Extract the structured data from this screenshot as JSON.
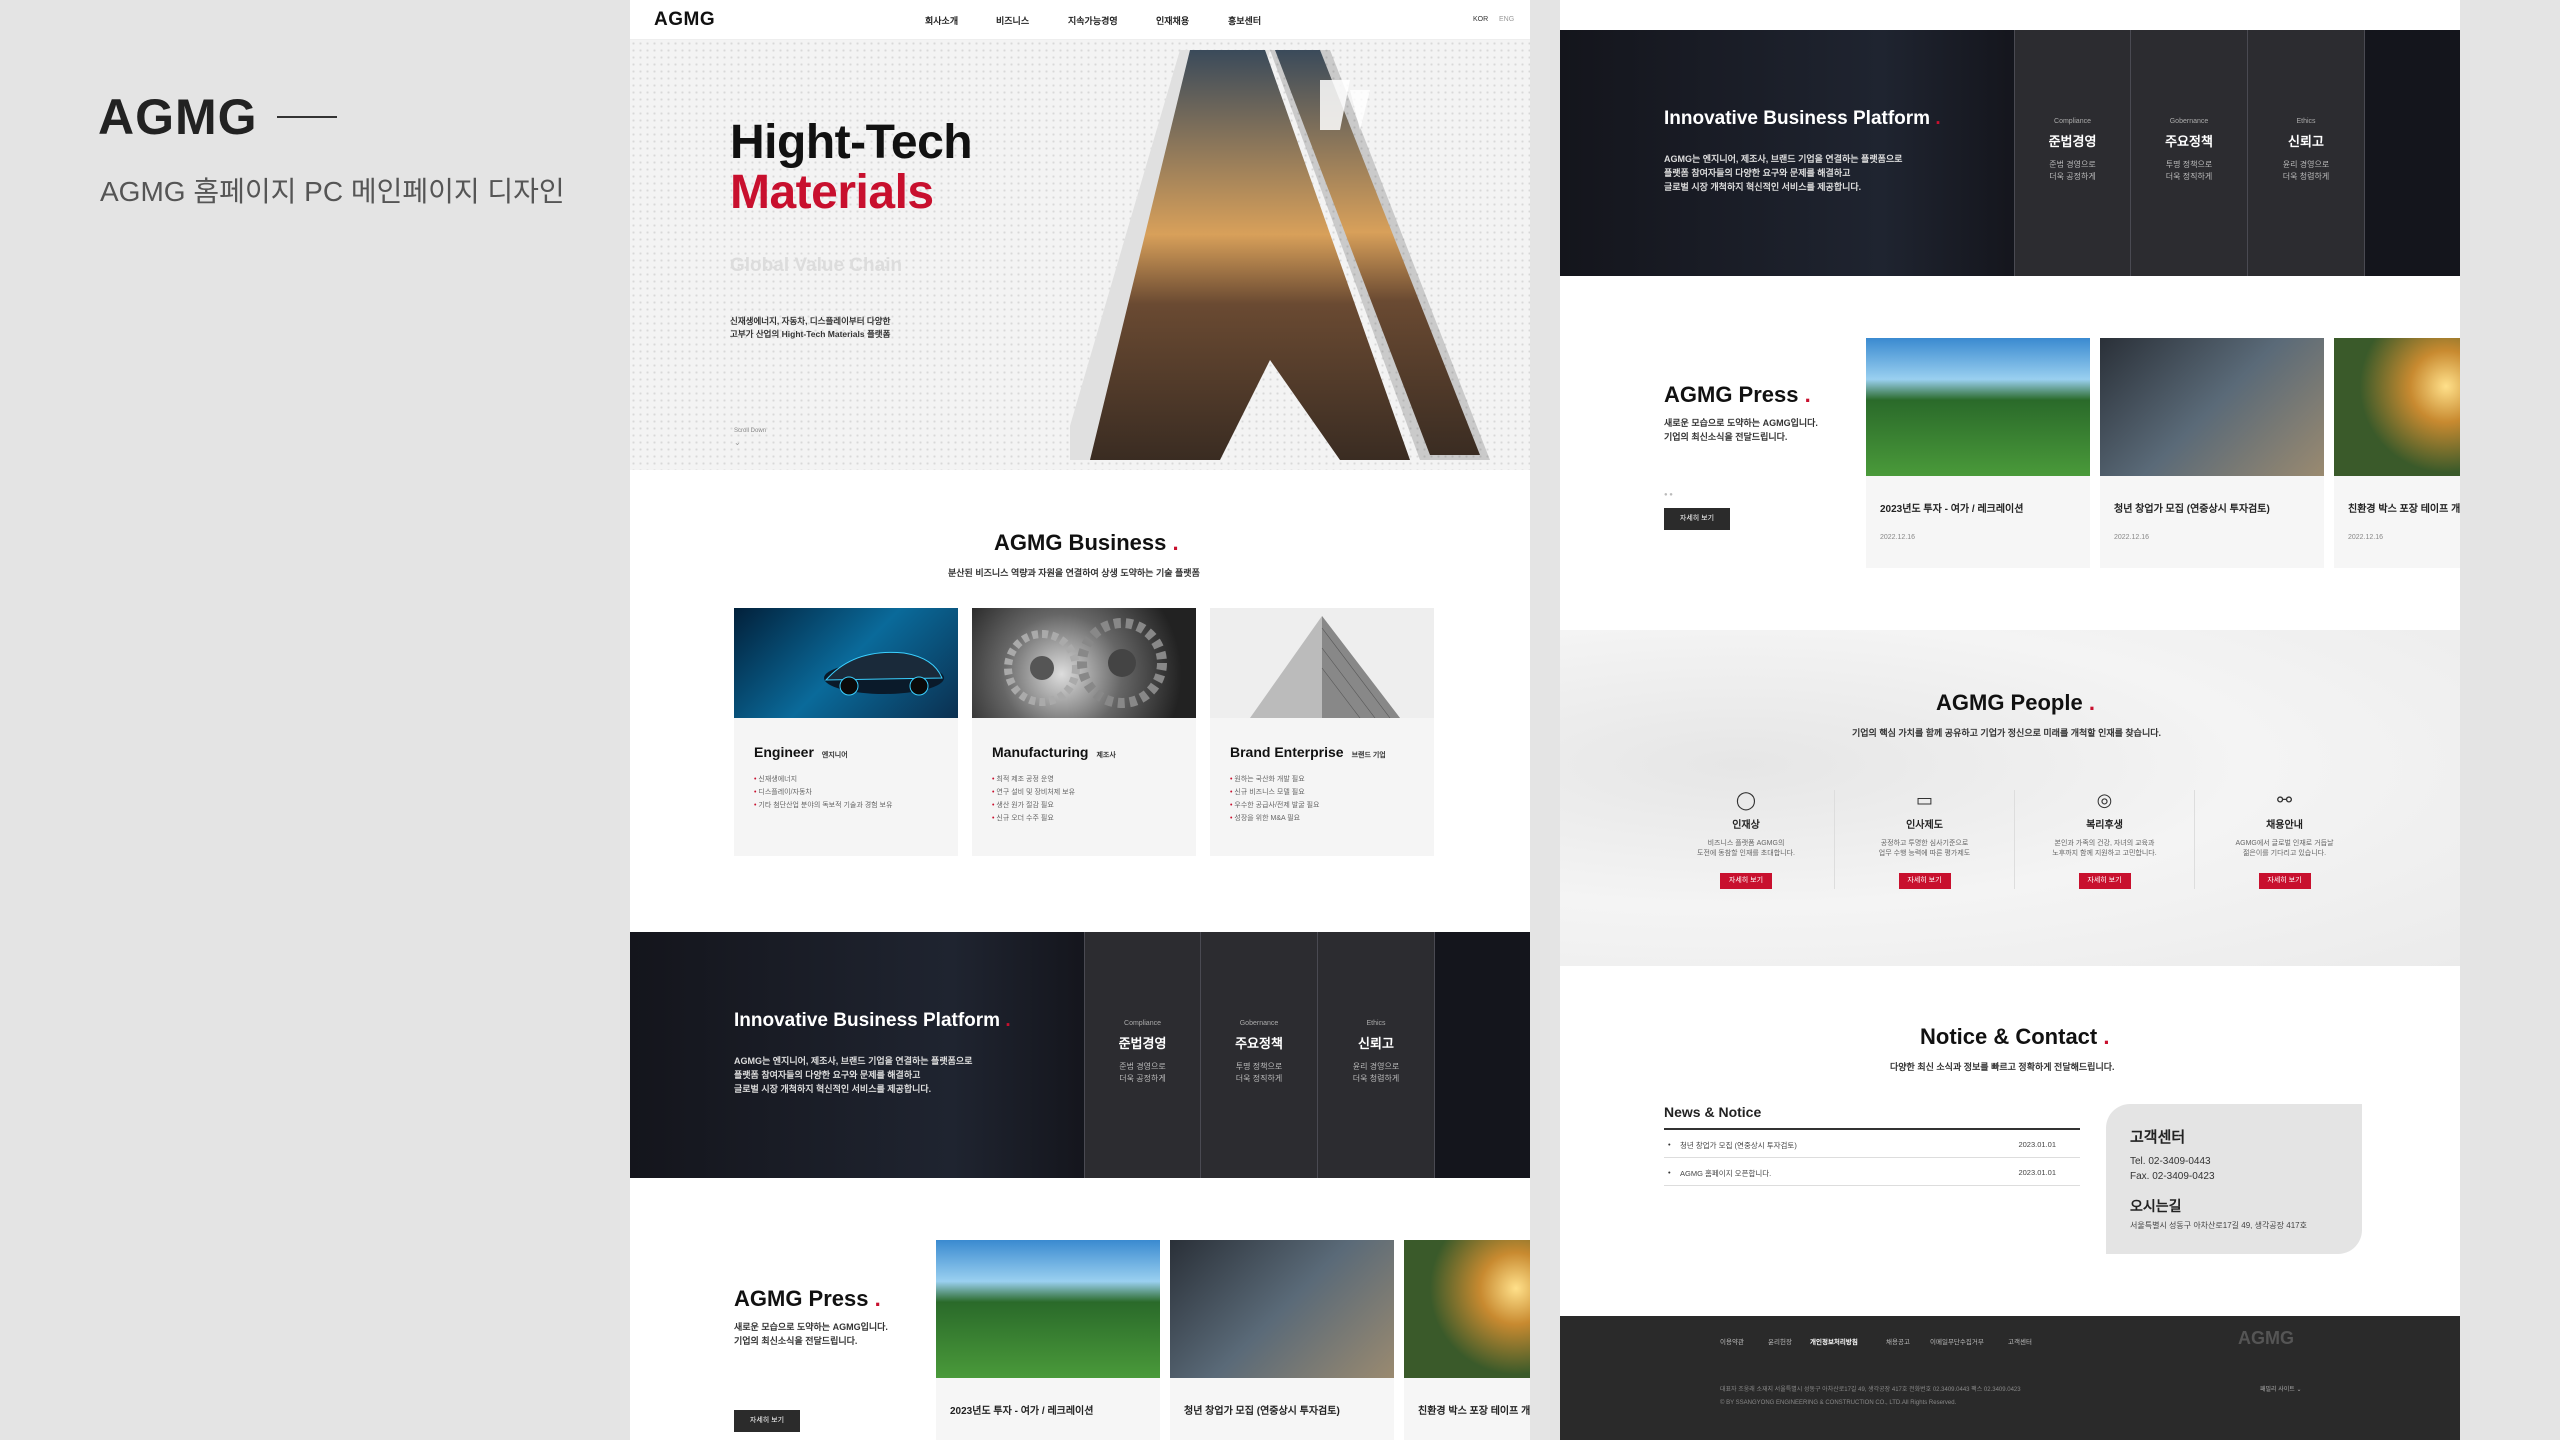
{
  "caption": {
    "title": "AGMG",
    "subtitle": "AGMG 홈페이지 PC 메인페이지 디자인"
  },
  "header": {
    "logo": "AGMG",
    "nav": [
      "회사소개",
      "비즈니스",
      "지속가능경영",
      "인재채용",
      "홍보센터"
    ],
    "lang_kor": "KOR",
    "lang_eng": "ENG"
  },
  "hero": {
    "title_line1": "Hight-Tech",
    "title_line2": "Materials",
    "tagline": "Global Value Chain",
    "desc_line1": "신재생에너지, 자동차, 디스플레이부터 다양한",
    "desc_line2": "고부가 산업의 Hight-Tech Materials 플랫폼",
    "scroll": "Scroll Down"
  },
  "business": {
    "title": "AGMG Business",
    "subtitle": "분산된 비즈니스 역량과 자원을 연결하여 상생 도약하는 기술 플랫폼",
    "cards": [
      {
        "title": "Engineer",
        "tag": "엔지니어",
        "items": [
          "신재생에너지",
          "디스플레이/자동차",
          "기타 첨단산업 분야의 독보적 기술과 경험 보유"
        ]
      },
      {
        "title": "Manufacturing",
        "tag": "제조사",
        "items": [
          "최적 제조 공정 운영",
          "연구 설비 및 장비처제 보유",
          "생산 원가 절감 필요",
          "신규 오더 수주 필요"
        ]
      },
      {
        "title": "Brand Enterprise",
        "tag": "브랜드 기업",
        "items": [
          "원하는 국산화 개발 필요",
          "신규 비즈니스 모델 필요",
          "우수한 공급사/전제 발굴 필요",
          "성장을 위한 M&A 필요"
        ]
      }
    ]
  },
  "platform": {
    "title": "Innovative Business Platform",
    "desc_line1": "AGMG는 엔지니어, 제조사, 브랜드 기업을 연결하는 플랫폼으로",
    "desc_line2": "플랫폼 참여자들의 다양한 요구와 문제를 해결하고",
    "desc_line3": "글로벌 시장 개척하지 혁신적인 서비스를 제공합니다.",
    "cols": [
      {
        "en": "Compliance",
        "ko": "준법경영",
        "d1": "준법 경영으로",
        "d2": "더욱 공정하게"
      },
      {
        "en": "Gobernance",
        "ko": "주요정책",
        "d1": "투명 정책으로",
        "d2": "더욱 정직하게"
      },
      {
        "en": "Ethics",
        "ko": "신뢰고",
        "d1": "윤리 경영으로",
        "d2": "더욱 청렴하게"
      }
    ]
  },
  "press": {
    "title": "AGMG Press",
    "desc_line1": "새로운 모습으로 도약하는 AGMG입니다.",
    "desc_line2": "기업의 최신소식을 전달드립니다.",
    "button": "자세히 보기",
    "items": [
      {
        "title": "2023년도 투자 - 여가 / 레크레이션",
        "date": "2022.12.16"
      },
      {
        "title": "청년 창업가 모집 (연중상시 투자검토)",
        "date": "2022.12.16"
      },
      {
        "title": "친환경 박스 포장 테이프 개발",
        "date": "2022.12.16"
      }
    ]
  },
  "people": {
    "title": "AGMG People",
    "subtitle": "기업의 핵심 가치를 함께 공유하고 기업가 정신으로 미래를 개척할 인재를 찾습니다.",
    "items": [
      {
        "name": "인재상",
        "d1": "비즈니스 플랫폼 AGMG의",
        "d2": "도전에 동참할 인재를 초대합니다.",
        "btn": "자세히 보기"
      },
      {
        "name": "인사제도",
        "d1": "공정하고 투명한 심사기준으로",
        "d2": "업무 수행 능력에 따른 평가제도",
        "btn": "자세히 보기"
      },
      {
        "name": "복리후생",
        "d1": "본인과 가족의 건강, 자녀의 교육과",
        "d2": "노후까지 함께 지원하고 고민합니다.",
        "btn": "자세히 보기"
      },
      {
        "name": "채용안내",
        "d1": "AGMG에서 글로벌 인재로 거듭날",
        "d2": "젊은이를 기다리고 있습니다.",
        "btn": "자세히 보기"
      }
    ]
  },
  "notice": {
    "title": "Notice & Contact",
    "subtitle": "다양한 최신 소식과 정보를 빠르고 정확하게 전달해드립니다.",
    "news_title": "News & Notice",
    "rows": [
      {
        "text": "청년 창업가 모집 (연중상시 투자검토)",
        "date": "2023.01.01"
      },
      {
        "text": "AGMG 홈페이지 오픈합니다.",
        "date": "2023.01.01"
      }
    ],
    "cs_title": "고객센터",
    "tel": "Tel. 02-3409-0443",
    "fax": "Fax. 02-3409-0423",
    "loc_title": "오시는길",
    "address": "서울특별시 성동구 아차산로17길 49, 생각공장 417호"
  },
  "footer": {
    "links": [
      "이용약관",
      "윤리헌장",
      "개인정보처리방침",
      "채용공고",
      "이메일무단수집거부",
      "고객센터"
    ],
    "logo": "AGMG",
    "info": "대표자 조웅래    소재지 서울특별시 성동구 아차산로17길 49, 생각공장 417호    전화번호 02.3409.0443    팩스 02.3409.0423",
    "copyright": "© BY SSANGYONG ENGINEERING & CONSTRUCTION CO., LTD.All Rights Reserved.",
    "family": "패밀리 사이트  ⌄"
  },
  "colors": {
    "accent": "#c8102e",
    "dark": "#14151c"
  }
}
